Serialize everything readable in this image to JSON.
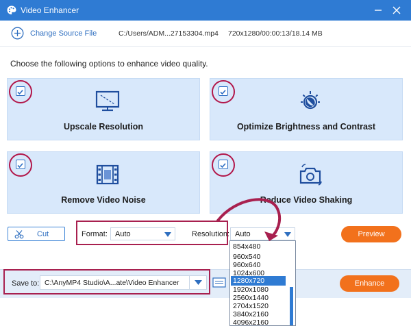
{
  "window": {
    "title": "Video Enhancer",
    "accent": "#2f7bd3",
    "icons": {
      "logo": "palette-icon",
      "minimize": "minimize-icon",
      "close": "close-icon"
    }
  },
  "source": {
    "change_label": "Change Source File",
    "path": "C:/Users/ADM...27153304.mp4",
    "info": "720x1280/00:00:13/18.14 MB"
  },
  "instruction": "Choose the following options to enhance video quality.",
  "options": [
    {
      "label": "Upscale Resolution",
      "checked": true,
      "icon": "monitor-icon"
    },
    {
      "label": "Optimize Brightness and Contrast",
      "checked": true,
      "icon": "brightness-icon"
    },
    {
      "label": "Remove Video Noise",
      "checked": true,
      "icon": "film-icon"
    },
    {
      "label": "Reduce Video Shaking",
      "checked": true,
      "icon": "camera-stabilize-icon"
    }
  ],
  "settings": {
    "cut_label": "Cut",
    "format_label": "Format:",
    "format_value": "Auto",
    "resolution_label": "Resolution:",
    "resolution_value": "Auto",
    "preview_label": "Preview"
  },
  "resolution_options": [
    "854x480",
    "960x540",
    "960x640",
    "1024x600",
    "1280x720",
    "1920x1080",
    "2560x1440",
    "2704x1520",
    "3840x2160",
    "4096x2160"
  ],
  "resolution_selected": "1280x720",
  "save": {
    "label": "Save to:",
    "path": "C:\\AnyMP4 Studio\\A...ate\\Video Enhancer",
    "enhance_label": "Enhance"
  },
  "colors": {
    "highlight": "#a8204f",
    "orange": "#f2711c",
    "card": "#d8e8fb"
  }
}
